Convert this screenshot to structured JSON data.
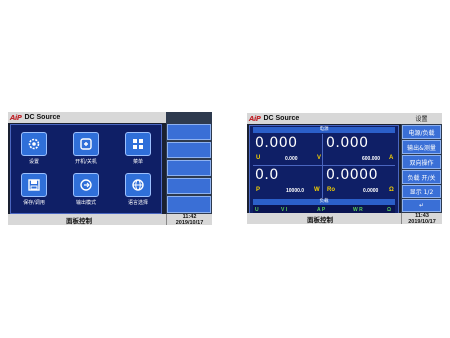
{
  "screen1": {
    "logo": "AiP",
    "title": "DC Source",
    "tiles": [
      {
        "label": "设置",
        "icon": "gear-icon"
      },
      {
        "label": "开机/关机",
        "icon": "power-icon"
      },
      {
        "label": "菜单",
        "icon": "menu-icon"
      },
      {
        "label": "保存/调用",
        "icon": "save-icon"
      },
      {
        "label": "输出模式",
        "icon": "output-mode-icon"
      },
      {
        "label": "语言选择",
        "icon": "globe-icon"
      }
    ],
    "side_buttons": [
      "",
      "",
      "",
      "",
      ""
    ],
    "bottom_label": "面板控制",
    "time": "11:42",
    "date": "2019/10/17"
  },
  "screen2": {
    "logo": "AiP",
    "title": "DC Source",
    "header_power": "电源",
    "voltage_value": "0.000",
    "voltage_unit": "U",
    "voltage_small": "0.000",
    "voltage_small_unit": "V",
    "current_value": "0.000",
    "current_small": "600.000",
    "current_small_unit": "A",
    "power_value": "0.0",
    "power_unit": "P",
    "power_small": "10000.0",
    "power_small_unit": "W",
    "res_value": "0.0000",
    "res_unit": "Ro",
    "res_small": "0.0000",
    "res_small_unit": "Ω",
    "header_load": "负载",
    "status_row": [
      "U",
      "V I",
      "A P",
      "W R",
      "Ω"
    ],
    "side_title": "设置",
    "side_buttons": [
      "电源/负载",
      "输出&测量",
      "双向操作",
      "负载 开/关",
      "显示 1/2",
      "↵"
    ],
    "bottom_label": "面板控制",
    "time": "11:43",
    "date": "2019/10/17"
  }
}
